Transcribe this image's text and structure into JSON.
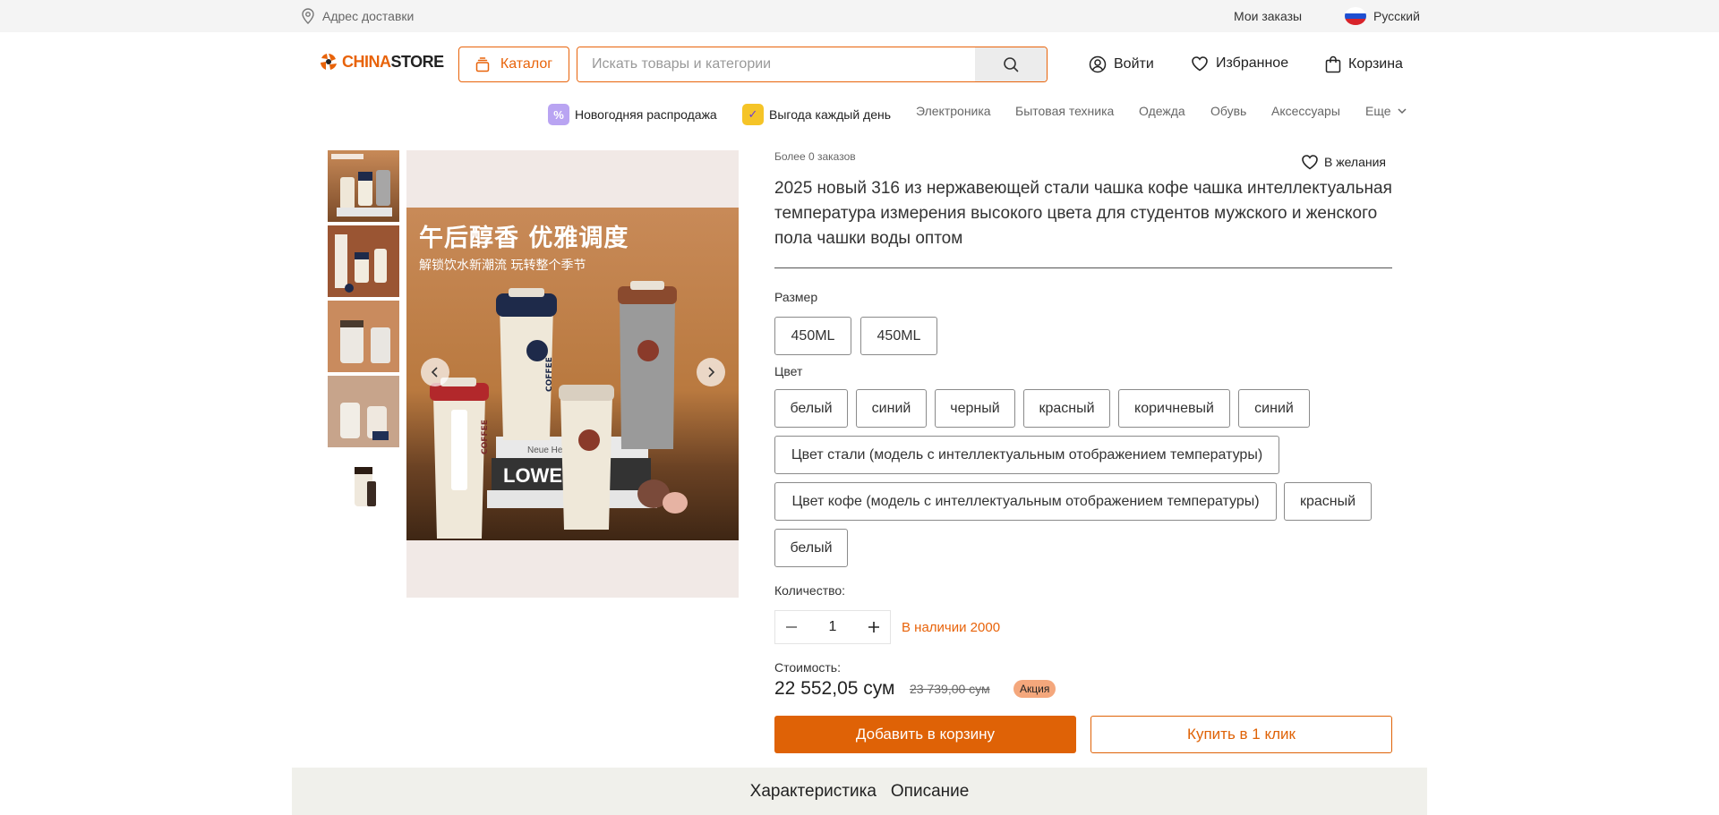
{
  "topbar": {
    "address_label": "Адрес доставки",
    "orders_label": "Мои заказы",
    "language_label": "Русский"
  },
  "header": {
    "logo_part1": "CHINA",
    "logo_part2": "STORE",
    "catalog_label": "Каталог",
    "search_placeholder": "Искать товары и категории",
    "login_label": "Войти",
    "favorites_label": "Избранное",
    "cart_label": "Корзина"
  },
  "nav": {
    "promo1": "Новогодняя распродажа",
    "promo2": "Выгода каждый день",
    "items": [
      "Электроника",
      "Бытовая техника",
      "Одежда",
      "Обувь",
      "Аксессуары"
    ],
    "more_label": "Еще"
  },
  "gallery": {
    "photo_title": "午后醇香 优雅调度",
    "photo_subtitle": "解锁饮水新潮流 玩转整个季节",
    "book_text": "LOWER",
    "book_small": "Neue Helv",
    "cup_label": "COFFEE"
  },
  "product": {
    "orders_text": "Более 0 заказов",
    "wishlist_label": "В желания",
    "title": "2025 новый 316 из нержавеющей стали чашка кофе чашка интеллектуальная температура измерения высокого цвета для студентов мужского и женского пола чашки воды оптом",
    "size_label": "Размер",
    "sizes": [
      "450ML",
      "450ML"
    ],
    "color_label": "Цвет",
    "colors": [
      "белый",
      "синий",
      "черный",
      "красный",
      "коричневый",
      "синий",
      "Цвет стали (модель с интеллектуальным отображением температуры)",
      "Цвет кофе (модель с интеллектуальным отображением температуры)",
      "красный",
      "белый"
    ],
    "quantity_label": "Количество:",
    "quantity_value": "1",
    "stock_text": "В наличии 2000",
    "cost_label": "Стоимость:",
    "price": "22 552,05 сум",
    "old_price": "23 739,00 сум",
    "sale_badge": "Акция",
    "add_to_cart_label": "Добавить в корзину",
    "buy_one_click_label": "Купить в 1 клик"
  },
  "tabs": [
    "Характеристика",
    "Описание"
  ],
  "colors": {
    "accent": "#e8630a",
    "button": "#df6206",
    "sale_badge": "#f4a77c",
    "topbar_bg": "#f4f4f4",
    "tabsbar_bg": "#f0f0eb"
  }
}
